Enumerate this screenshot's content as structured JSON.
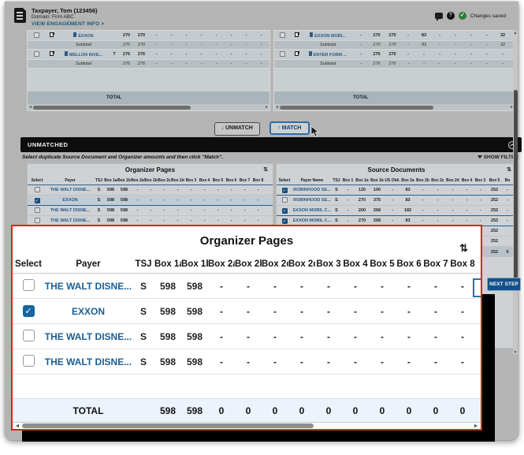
{
  "colors": {
    "accent_blue": "#1565a0",
    "link_blue": "#1b5e93",
    "popup_border_red": "#d0281f",
    "saved_green": "#2e7d36",
    "next_step_bg": "#12518a",
    "total_row_bg": "#ecf3fa"
  },
  "header": {
    "taxpayer_name": "Taxpayer, Tom (123456)",
    "domain": "Domain: Firm ABC",
    "engagement_link": "VIEW ENGAGEMENT INFO >",
    "changes_saved": "Changes saved",
    "help_glyph": "?",
    "saved_glyph": "✓"
  },
  "matched": {
    "left": {
      "total_label": "TOTAL",
      "rows": [
        {
          "type": "doc",
          "payer": "EXXON",
          "tsj": "",
          "values": [
            "270",
            "270",
            "-",
            "-",
            "-",
            "-",
            "-",
            "-",
            "-",
            "-"
          ]
        },
        {
          "type": "subtotal",
          "label": "Subtotal",
          "tsj": "",
          "values": [
            "270",
            "270",
            "-",
            "-",
            "-",
            "-",
            "-",
            "-",
            "-",
            "-"
          ]
        },
        {
          "type": "doc",
          "payer": "MELLON INVE...",
          "tsj": "T",
          "values": [
            "276",
            "276",
            "-",
            "-",
            "-",
            "-",
            "-",
            "-",
            "-",
            "-"
          ]
        },
        {
          "type": "subtotal",
          "label": "Subtotal",
          "tsj": "",
          "values": [
            "276",
            "276",
            "-",
            "-",
            "-",
            "-",
            "-",
            "-",
            "-",
            "-"
          ]
        }
      ]
    },
    "right": {
      "total_label": "TOTAL",
      "rows": [
        {
          "type": "doc",
          "payer": "EXXON MOBI...",
          "tsj": "",
          "values": [
            "-",
            "270",
            "270",
            "-",
            "83",
            "-",
            "-",
            "-",
            "-",
            "32"
          ]
        },
        {
          "type": "subtotal",
          "label": "Subtotal",
          "tsj": "",
          "values": [
            "-",
            "270",
            "270",
            "-",
            "83",
            "-",
            "-",
            "-",
            "-",
            "32"
          ]
        },
        {
          "type": "doc",
          "payer": "ENTER FORM ...",
          "tsj": "",
          "values": [
            "-",
            "276",
            "276",
            "-",
            "-",
            "-",
            "-",
            "-",
            "-",
            "-"
          ]
        },
        {
          "type": "subtotal",
          "label": "Subtotal",
          "tsj": "",
          "values": [
            "-",
            "276",
            "276",
            "-",
            "-",
            "-",
            "-",
            "-",
            "-",
            "-"
          ]
        }
      ]
    }
  },
  "actions": {
    "unmatch_label": "UNMATCH",
    "match_label": "MATCH"
  },
  "icons": {
    "down_arrow": "↓",
    "up_arrow": "↑",
    "sort": "⇅",
    "left_arrow": "◄",
    "right_arrow": "►",
    "up_tri": "▲",
    "down_tri": "▼"
  },
  "unmatched": {
    "bar_title": "UNMATCHED",
    "instruction": "Select duplicate Source Document and Organizer amounts and then click \"Match\".",
    "show_filter_label": "SHOW FILTER"
  },
  "organizer": {
    "title": "Organizer Pages",
    "headers": [
      "Select",
      "Payer",
      "TSJ",
      "Box 1a",
      "Box 1b",
      "Box 2a",
      "Box 2b",
      "Box 2c",
      "Box 2d",
      "Box 3",
      "Box 4",
      "Box 5",
      "Box 6",
      "Box 7",
      "Box 8"
    ],
    "rows": [
      {
        "checked": false,
        "payer": "THE WALT DISNE...",
        "tsj": "S",
        "values": [
          "598",
          "598",
          "-",
          "-",
          "-",
          "-",
          "-",
          "-",
          "-",
          "-",
          "-",
          "-"
        ]
      },
      {
        "checked": true,
        "payer": "EXXON",
        "tsj": "S",
        "values": [
          "598",
          "598",
          "-",
          "-",
          "-",
          "-",
          "-",
          "-",
          "-",
          "-",
          "-",
          "-"
        ]
      },
      {
        "checked": false,
        "payer": "THE WALT DISNE...",
        "tsj": "S",
        "values": [
          "598",
          "598",
          "-",
          "-",
          "-",
          "-",
          "-",
          "-",
          "-",
          "-",
          "-",
          "-"
        ]
      },
      {
        "checked": false,
        "payer": "THE WALT DISNE...",
        "tsj": "S",
        "values": [
          "598",
          "598",
          "-",
          "-",
          "-",
          "-",
          "-",
          "-",
          "-",
          "-",
          "-",
          "-"
        ]
      }
    ]
  },
  "source_documents": {
    "title": "Source Documents",
    "headers": [
      "Select",
      "Payer Name",
      "TSJ",
      "Box 1",
      "Box 1a",
      "Box 1b",
      "US Obli.",
      "Box 2a",
      "Box 2b",
      "Box 2c",
      "Box 2d",
      "Box 4",
      "Box 3",
      "Box 5",
      "Bo"
    ],
    "rows": [
      {
        "checked": true,
        "payer": "ROBINHOOD SE...",
        "tsj": "S",
        "values": [
          "-",
          "120",
          "100",
          "-",
          "83",
          "-",
          "-",
          "-",
          "-",
          "-",
          "252",
          "-"
        ]
      },
      {
        "checked": false,
        "payer": "ROBINHOOD SE...",
        "tsj": "S",
        "values": [
          "-",
          "270",
          "375",
          "-",
          "83",
          "-",
          "-",
          "-",
          "-",
          "-",
          "252",
          "-"
        ]
      },
      {
        "checked": true,
        "payer": "EXXON MOBIL C...",
        "tsj": "S",
        "values": [
          "-",
          "200",
          "268",
          "-",
          "182",
          "-",
          "-",
          "-",
          "-",
          "-",
          "252",
          "-"
        ]
      },
      {
        "checked": true,
        "payer": "EXXON MOBIL C...",
        "tsj": "S",
        "values": [
          "-",
          "270",
          "268",
          "-",
          "83",
          "-",
          "-",
          "-",
          "-",
          "-",
          "252",
          "-"
        ]
      },
      {
        "checked": false,
        "payer": "",
        "tsj": "",
        "values": [
          "",
          "",
          "",
          "",
          "",
          "",
          "",
          "",
          "",
          "",
          "252",
          ""
        ]
      },
      {
        "checked": false,
        "payer": "",
        "tsj": "",
        "values": [
          "",
          "",
          "",
          "",
          "",
          "",
          "",
          "",
          "",
          "",
          "252",
          ""
        ]
      }
    ],
    "total": {
      "label": "",
      "values": [
        "",
        "",
        "",
        "",
        "",
        "",
        "",
        "",
        "",
        "",
        "252",
        "0"
      ]
    }
  },
  "next_step_label": "NEXT STEP",
  "popup": {
    "title": "Organizer Pages",
    "headers": [
      "Select",
      "Payer",
      "TSJ",
      "Box 1a",
      "Box 1b",
      "Box 2a",
      "Box 2b",
      "Box 2c",
      "Box 2d",
      "Box 3",
      "Box 4",
      "Box 5",
      "Box 6",
      "Box 7",
      "Box 8"
    ],
    "rows": [
      {
        "checked": false,
        "payer": "THE WALT DISNE...",
        "tsj": "S",
        "values": [
          "598",
          "598",
          "-",
          "-",
          "-",
          "-",
          "-",
          "-",
          "-",
          "-",
          "-",
          "-"
        ]
      },
      {
        "checked": true,
        "payer": "EXXON",
        "tsj": "S",
        "values": [
          "598",
          "598",
          "-",
          "-",
          "-",
          "-",
          "-",
          "-",
          "-",
          "-",
          "-",
          "-"
        ]
      },
      {
        "checked": false,
        "payer": "THE WALT DISNE...",
        "tsj": "S",
        "values": [
          "598",
          "598",
          "-",
          "-",
          "-",
          "-",
          "-",
          "-",
          "-",
          "-",
          "-",
          "-"
        ]
      },
      {
        "checked": false,
        "payer": "THE WALT DISNE...",
        "tsj": "S",
        "values": [
          "598",
          "598",
          "-",
          "-",
          "-",
          "-",
          "-",
          "-",
          "-",
          "-",
          "-",
          "-"
        ]
      }
    ],
    "total": {
      "label": "TOTAL",
      "values": [
        "598",
        "598",
        "0",
        "0",
        "0",
        "0",
        "0",
        "0",
        "0",
        "0",
        "0",
        "0"
      ]
    }
  }
}
